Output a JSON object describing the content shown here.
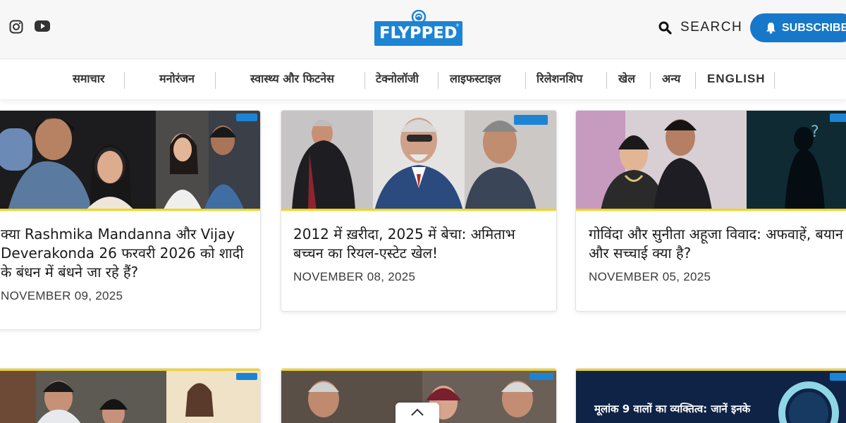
{
  "header": {
    "brand": "FLYPPED",
    "search_label": "SEARCH",
    "subscribe_label": "SUBSCRIBE",
    "social": [
      "instagram-icon",
      "youtube-icon"
    ],
    "colors": {
      "brand_blue": "#1d84d4",
      "subscribe_blue": "#1778c9",
      "accent_yellow": "#f3d41c"
    }
  },
  "nav": {
    "items": [
      {
        "label": "समाचार"
      },
      {
        "label": "मनोरंजन"
      },
      {
        "label": "स्वास्थ्य और फिटनेस"
      },
      {
        "label": "टेक्नोलॉजी"
      },
      {
        "label": "लाइफस्टाइल"
      },
      {
        "label": "रिलेशनशिप"
      },
      {
        "label": "खेल"
      },
      {
        "label": "अन्य"
      },
      {
        "label": "ENGLISH"
      }
    ]
  },
  "articles": [
    {
      "title": "क्या Rashmika Mandanna और Vijay Deverakonda 26 फरवरी 2026 को शादी के बंधन में बंधने जा रहे हैं?",
      "date": "NOVEMBER 09, 2025"
    },
    {
      "title": "2012 में ख़रीदा, 2025 में बेचा: अमिताभ बच्चन का रियल-एस्टेट खेल!",
      "date": "NOVEMBER 08, 2025"
    },
    {
      "title": "गोविंदा और सुनीता अहूजा विवाद: अफवाहें, बयान और सच्चाई क्या है?",
      "date": "NOVEMBER 05, 2025"
    }
  ],
  "row2": {
    "thumb3_text": "मूलांक 9 वालों का व्यक्तित्व: जानें इनके"
  }
}
